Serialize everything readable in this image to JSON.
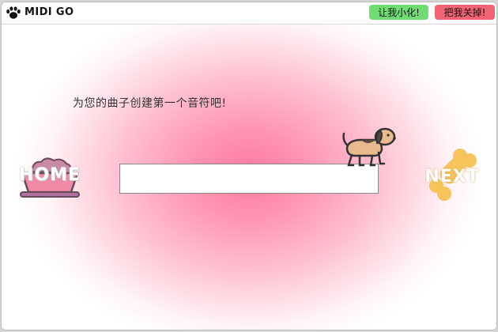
{
  "window": {
    "title": "MIDI GO",
    "icon": "paw-icon",
    "minimize_label": "让我小化!",
    "close_label": "把我关掉!"
  },
  "main": {
    "prompt": "为您的曲子创建第一个音符吧!",
    "note_input": {
      "value": "",
      "placeholder": ""
    },
    "home_label": "HOME",
    "next_label": "NEXT",
    "home_icon": "food-bowl-icon",
    "next_icon": "bone-icon",
    "mascot_icon": "dog-icon"
  },
  "colors": {
    "minimize_button": "#6fdc74",
    "close_button": "#f26474",
    "glow": "#ff7aa0",
    "bone": "#f7c35b"
  }
}
